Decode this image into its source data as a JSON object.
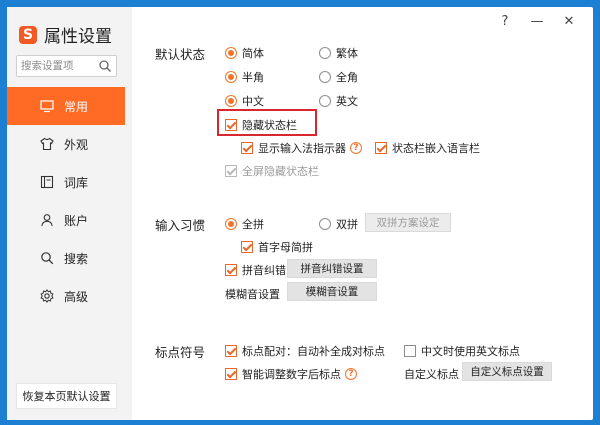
{
  "app": {
    "title": "属性设置"
  },
  "search": {
    "placeholder": "搜索设置项"
  },
  "sidebar": {
    "items": [
      {
        "label": "常用",
        "icon": "monitor-icon",
        "active": true
      },
      {
        "label": "外观",
        "icon": "shirt-icon",
        "active": false
      },
      {
        "label": "词库",
        "icon": "book-icon",
        "active": false
      },
      {
        "label": "账户",
        "icon": "user-icon",
        "active": false
      },
      {
        "label": "搜索",
        "icon": "search-icon",
        "active": false
      },
      {
        "label": "高级",
        "icon": "gear-icon",
        "active": false
      }
    ],
    "restore_label": "恢复本页默认设置"
  },
  "window_controls": {
    "help": "?",
    "minimize": "—",
    "close": "✕"
  },
  "default_state": {
    "label": "默认状态",
    "simplified": "简体",
    "traditional": "繁体",
    "half_width": "半角",
    "full_width": "全角",
    "chinese": "中文",
    "english": "英文",
    "hide_status_bar": "隐藏状态栏",
    "show_ime_indicator": "显示输入法指示器",
    "embed_language_bar": "状态栏嵌入语言栏",
    "fullscreen_hide": "全屏隐藏状态栏"
  },
  "input_habit": {
    "label": "输入习惯",
    "full_pinyin": "全拼",
    "double_pinyin": "双拼",
    "double_scheme_button": "双拼方案设定",
    "initial_abbrev": "首字母简拼",
    "pinyin_correction": "拼音纠错",
    "pinyin_correction_button": "拼音纠错设置",
    "fuzzy_label": "模糊音设置",
    "fuzzy_button": "模糊音设置"
  },
  "punctuation": {
    "label": "标点符号",
    "pairing": "标点配对：自动补全成对标点",
    "chinese_use_english": "中文时使用英文标点",
    "smart_adjust": "智能调整数字后标点",
    "custom_label": "自定义标点",
    "custom_button": "自定义标点设置"
  },
  "colors": {
    "accent": "#ff6b24",
    "highlight": "#d8272f",
    "background": "#1c7fd2"
  }
}
